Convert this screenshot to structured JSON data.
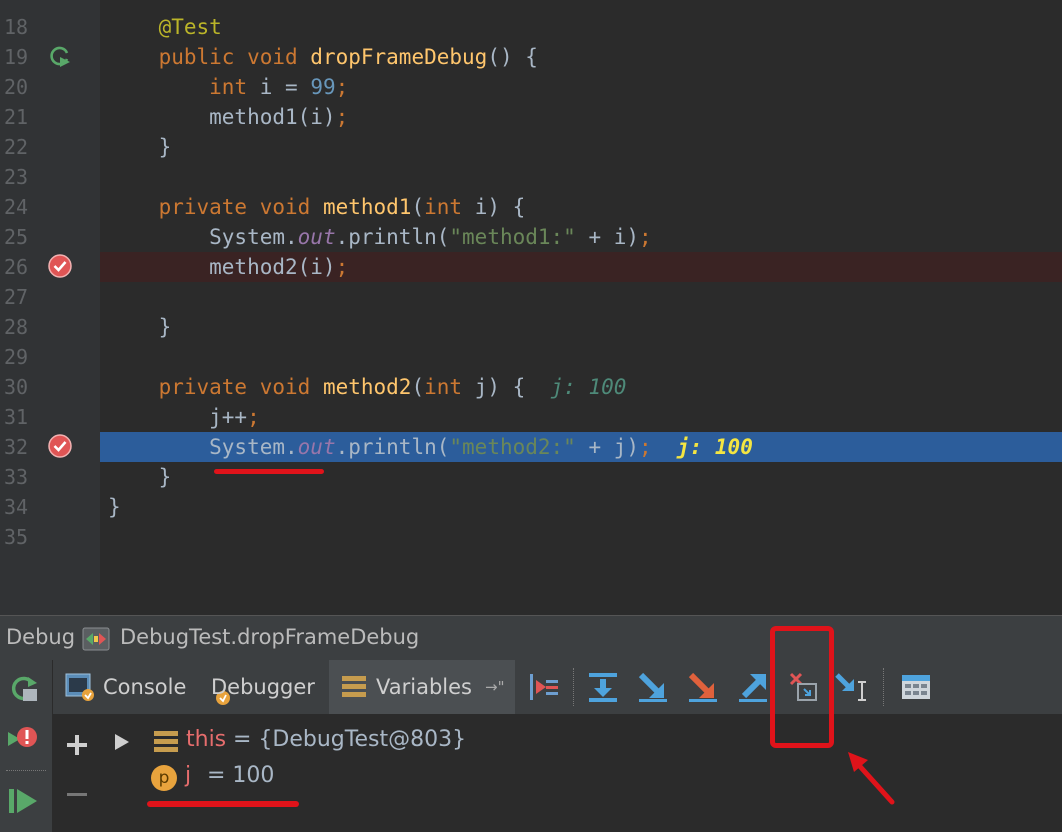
{
  "editor": {
    "line_numbers": [
      "18",
      "19",
      "20",
      "21",
      "22",
      "23",
      "24",
      "25",
      "26",
      "27",
      "28",
      "29",
      "30",
      "31",
      "32",
      "33",
      "34",
      "35"
    ],
    "lines": [
      [
        {
          "t": "    ",
          "c": ""
        },
        {
          "t": "@Test",
          "c": "an"
        }
      ],
      [
        {
          "t": "    ",
          "c": ""
        },
        {
          "t": "public void ",
          "c": "kw"
        },
        {
          "t": "dropFrameDebug",
          "c": "fn"
        },
        {
          "t": "() {",
          "c": ""
        }
      ],
      [
        {
          "t": "        ",
          "c": ""
        },
        {
          "t": "int ",
          "c": "kw"
        },
        {
          "t": "i = ",
          "c": ""
        },
        {
          "t": "99",
          "c": "num"
        },
        {
          "t": ";",
          "c": "kw"
        }
      ],
      [
        {
          "t": "        method1(i)",
          "c": ""
        },
        {
          "t": ";",
          "c": "kw"
        }
      ],
      [
        {
          "t": "    }",
          "c": ""
        }
      ],
      [],
      [
        {
          "t": "    ",
          "c": ""
        },
        {
          "t": "private void ",
          "c": "kw"
        },
        {
          "t": "method1",
          "c": "fn"
        },
        {
          "t": "(",
          "c": ""
        },
        {
          "t": "int ",
          "c": "kw"
        },
        {
          "t": "i) {",
          "c": ""
        }
      ],
      [
        {
          "t": "        System.",
          "c": ""
        },
        {
          "t": "out",
          "c": "fld"
        },
        {
          "t": ".println(",
          "c": ""
        },
        {
          "t": "\"method1:\"",
          "c": "str"
        },
        {
          "t": " + i)",
          "c": ""
        },
        {
          "t": ";",
          "c": "kw"
        }
      ],
      [
        {
          "t": "        method2(i)",
          "c": ""
        },
        {
          "t": ";",
          "c": "kw"
        }
      ],
      [],
      [
        {
          "t": "    }",
          "c": ""
        }
      ],
      [],
      [
        {
          "t": "    ",
          "c": ""
        },
        {
          "t": "private void ",
          "c": "kw"
        },
        {
          "t": "method2",
          "c": "fn"
        },
        {
          "t": "(",
          "c": ""
        },
        {
          "t": "int ",
          "c": "kw"
        },
        {
          "t": "j) {  ",
          "c": ""
        },
        {
          "t": "j: 100",
          "c": "inl"
        }
      ],
      [
        {
          "t": "        j++",
          "c": ""
        },
        {
          "t": ";",
          "c": "kw"
        }
      ],
      [
        {
          "t": "        System.",
          "c": ""
        },
        {
          "t": "out",
          "c": "fld"
        },
        {
          "t": ".println(",
          "c": ""
        },
        {
          "t": "\"method2:\"",
          "c": "str"
        },
        {
          "t": " + j)",
          "c": ""
        },
        {
          "t": ";  ",
          "c": "kw"
        },
        {
          "t": "j: 100",
          "c": "inl2"
        }
      ],
      [
        {
          "t": "    }",
          "c": ""
        }
      ],
      [
        {
          "t": "}",
          "c": ""
        }
      ],
      []
    ]
  },
  "debug_header": {
    "title": "Debug",
    "session": "DebugTest.dropFrameDebug"
  },
  "tabs": {
    "console": "Console",
    "debugger": "Debugger",
    "variables": "Variables",
    "pin": "→\""
  },
  "variables": [
    {
      "name": "this",
      "value": "= {DebugTest@803}"
    },
    {
      "badge": "p",
      "name": "j",
      "value": "= 100"
    }
  ],
  "colors": {
    "annotation": "#e0131a",
    "selection": "#2c5d9b",
    "breakpoint": "#e05555"
  },
  "icons": [
    "rerun-icon",
    "stop-icon",
    "resume-icon",
    "console-icon",
    "debugger-icon",
    "variables-icon",
    "show-execution-point-icon",
    "step-over-icon",
    "step-into-icon",
    "force-step-into-icon",
    "step-out-icon",
    "drop-frame-icon",
    "run-to-cursor-icon",
    "evaluate-expression-icon",
    "add-watch-icon",
    "remove-watch-icon"
  ]
}
